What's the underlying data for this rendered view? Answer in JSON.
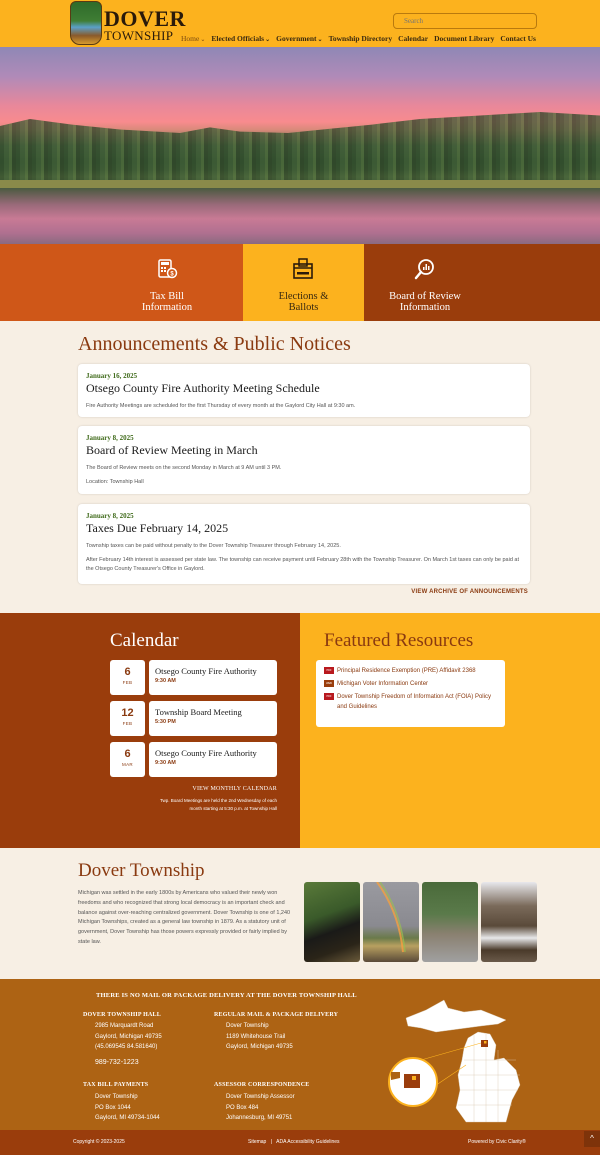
{
  "header": {
    "logo_line1": "DOVER",
    "logo_line2": "TOWNSHIP",
    "search_placeholder": "Search",
    "nav": [
      {
        "label": "Home",
        "has_dropdown": true
      },
      {
        "label": "Elected Officials",
        "has_dropdown": true
      },
      {
        "label": "Government",
        "has_dropdown": true
      },
      {
        "label": "Township Directory",
        "has_dropdown": false
      },
      {
        "label": "Calendar",
        "has_dropdown": false
      },
      {
        "label": "Document Library",
        "has_dropdown": false
      },
      {
        "label": "Contact Us",
        "has_dropdown": false
      }
    ],
    "chevron": "⌄"
  },
  "hero": {
    "alt": "Lake at sunset with autumn trees"
  },
  "quick_links": [
    {
      "label_line1": "Tax Bill",
      "label_line2": "Information",
      "icon": "calculator-icon",
      "color": "#cf5718"
    },
    {
      "label_line1": "Elections &",
      "label_line2": "Ballots",
      "icon": "ballot-box-icon",
      "color": "#fcb21e"
    },
    {
      "label_line1": "Board of Review",
      "label_line2": "Information",
      "icon": "magnifier-chart-icon",
      "color": "#9a3d0c"
    }
  ],
  "announcements": {
    "title": "Announcements & Public Notices",
    "items": [
      {
        "date": "January 16, 2025",
        "title": "Otsego County Fire Authority Meeting Schedule",
        "paragraphs": [
          "Fire Authority Meetings are scheduled for the first Thursday of every month at the Gaylord City Hall at 9:30 am."
        ]
      },
      {
        "date": "January 8, 2025",
        "title": "Board of Review Meeting in March",
        "paragraphs": [
          "The Board of Review meets on the second Monday in March at 9 AM until 3 PM.",
          "Location: Township Hall"
        ]
      },
      {
        "date": "January 8, 2025",
        "title": "Taxes Due February 14, 2025",
        "paragraphs": [
          "Township taxes can be paid without penalty to the Dover Township Treasurer through February 14, 2025.",
          "After February 14th interest is assessed per state law. The township can receive payment until February 28th with the Township Treasurer. On March 1st taxes can only be paid at the Otsego County Treasurer's Office in Gaylord."
        ]
      }
    ],
    "archive_link": "VIEW ARCHIVE OF ANNOUNCEMENTS"
  },
  "calendar": {
    "title": "Calendar",
    "events": [
      {
        "day": "6",
        "month": "FEB",
        "title": "Otsego County Fire Authority",
        "time": "9:30 AM"
      },
      {
        "day": "12",
        "month": "FEB",
        "title": "Township Board Meeting",
        "time": "5:30 PM"
      },
      {
        "day": "6",
        "month": "MAR",
        "title": "Otsego County Fire Authority",
        "time": "9:30 AM"
      }
    ],
    "link": "VIEW MONTHLY CALENDAR",
    "note_line1": "Twp. Board Meetings are held the 2nd Wednesday of each",
    "note_line2": "month starting at 5:30 p.m. at Township Hall"
  },
  "resources": {
    "title": "Featured Resources",
    "items": [
      {
        "badge": "PDF",
        "label": "Principal Residence Exemption (PRE) Affidavit 2368"
      },
      {
        "badge": "WEB",
        "label": "Michigan Voter Information Center"
      },
      {
        "badge": "PDF",
        "label": "Dover Township Freedom of Information Act (FOIA) Policy and Guidelines"
      }
    ]
  },
  "about": {
    "title": "Dover Township",
    "text": "Michigan was settled in the early 1800s by Americans who valued their newly won freedoms and who recognized that strong local democracy is an important check and balance against over-reaching centralized government. Dover Township is one of 1,240 Michigan Townships, created as a general law township in 1879. As a statutory unit of government, Dover Township has those powers expressly provided or fairly implied by state law.",
    "photos": [
      "black bear",
      "rainbow over field",
      "elk",
      "snowy river"
    ]
  },
  "footer": {
    "notice": "THERE IS NO MAIL OR PACKAGE DELIVERY AT THE DOVER TOWNSHIP HALL",
    "blocks": [
      {
        "heading": "DOVER TOWNSHIP HALL",
        "lines": [
          "2985 Marquardt Road",
          "Gaylord, Michigan 49735",
          "(45.069545 84.581640)"
        ],
        "phone": "989-732-1223"
      },
      {
        "heading": "REGULAR MAIL & PACKAGE DELIVERY",
        "lines": [
          "Dover Township",
          "1189 Whitehouse Trail",
          "Gaylord, Michigan 49735"
        ]
      },
      {
        "heading": "TAX BILL PAYMENTS",
        "lines": [
          "Dover Township",
          "PO Box 1044",
          "Gaylord, MI 49734-1044"
        ]
      },
      {
        "heading": "ASSESSOR CORRESPONDENCE",
        "lines": [
          "Dover Township Assessor",
          "PO Box 484",
          "Johannesburg, MI 49751"
        ]
      }
    ],
    "copyright": "Copyright © 2023-2025",
    "sitemap": "Sitemap",
    "separator": "|",
    "ada": "ADA Accessibility Guidelines",
    "powered": "Powered by Civic Clarity®",
    "top_button": "^"
  }
}
